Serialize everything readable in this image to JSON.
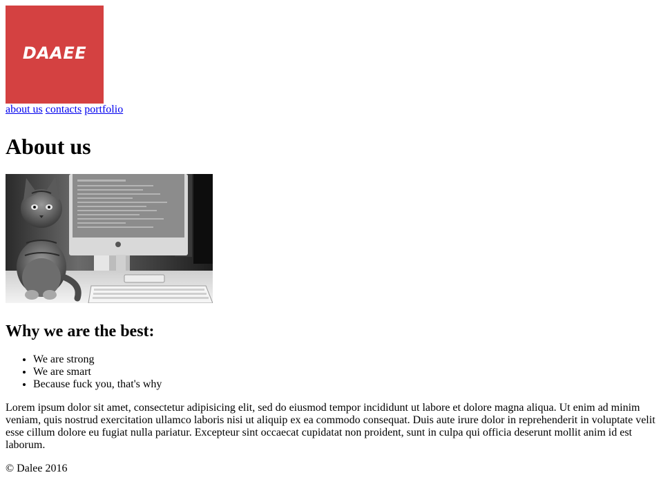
{
  "header": {
    "logo_text": "DAAEE"
  },
  "nav": {
    "items": [
      {
        "label": "about us"
      },
      {
        "label": "contacts"
      },
      {
        "label": "portfolio"
      }
    ]
  },
  "main": {
    "title": "About us",
    "photo_icon": "cat-photo-icon",
    "subtitle": "Why we are the best:",
    "reasons": [
      "We are strong",
      "We are smart",
      "Because fuck you, that's why"
    ],
    "body": "Lorem ipsum dolor sit amet, consectetur adipisicing elit, sed do eiusmod tempor incididunt ut labore et dolore magna aliqua. Ut enim ad minim veniam, quis nostrud exercitation ullamco laboris nisi ut aliquip ex ea commodo consequat. Duis aute irure dolor in reprehenderit in voluptate velit esse cillum dolore eu fugiat nulla pariatur. Excepteur sint occaecat cupidatat non proident, sunt in culpa qui officia deserunt mollit anim id est laborum."
  },
  "footer": {
    "copyright": "© Dalee 2016"
  },
  "colors": {
    "logo_background": "#d44141",
    "link": "#0000ee",
    "text": "#000000"
  }
}
